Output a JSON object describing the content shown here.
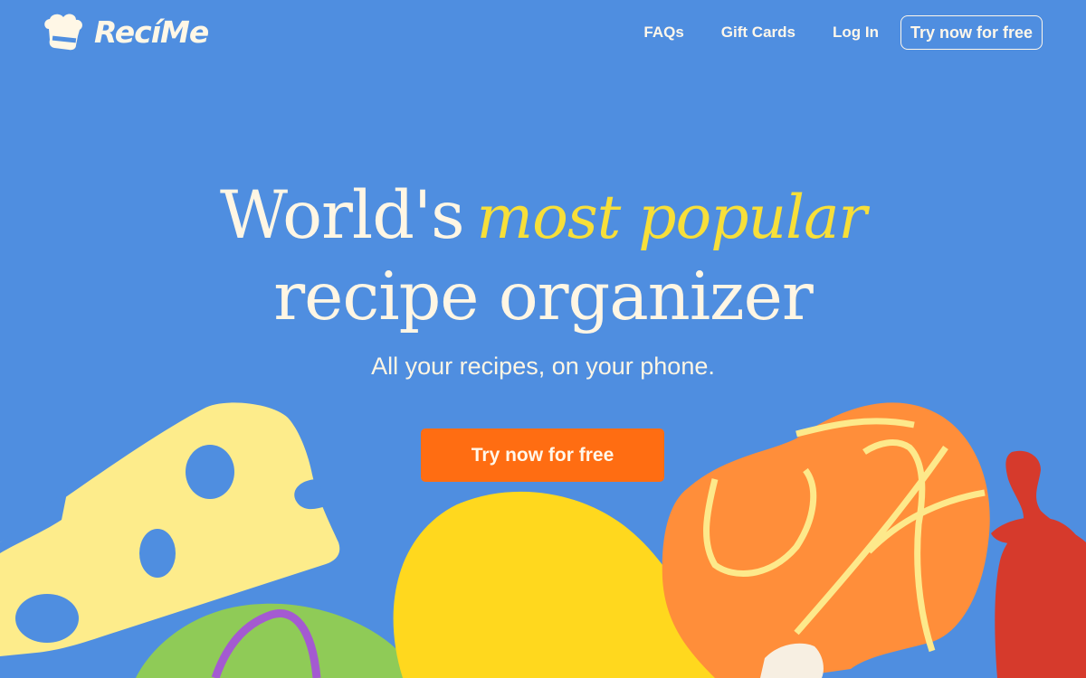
{
  "brand": {
    "name": "RecíMe",
    "colors": {
      "background": "#4f8ee0",
      "accent_yellow": "#f7df39",
      "cta_orange": "#ff6d12",
      "text_cream": "#fff6e4"
    }
  },
  "nav": {
    "items": [
      {
        "label": "FAQs"
      },
      {
        "label": "Gift Cards"
      },
      {
        "label": "Log In"
      }
    ],
    "cta_label": "Try now for free"
  },
  "hero": {
    "line1_plain": "World's",
    "line1_accent": "most popular",
    "line2": "recipe organizer",
    "subtitle": "All your recipes, on your phone.",
    "cta_label": "Try now for free"
  },
  "icons": {
    "logo": "chef-hat-icon"
  },
  "illustrations": [
    "cheese",
    "lettuce",
    "egg",
    "orange-bread",
    "chili-pepper",
    "garlic"
  ]
}
